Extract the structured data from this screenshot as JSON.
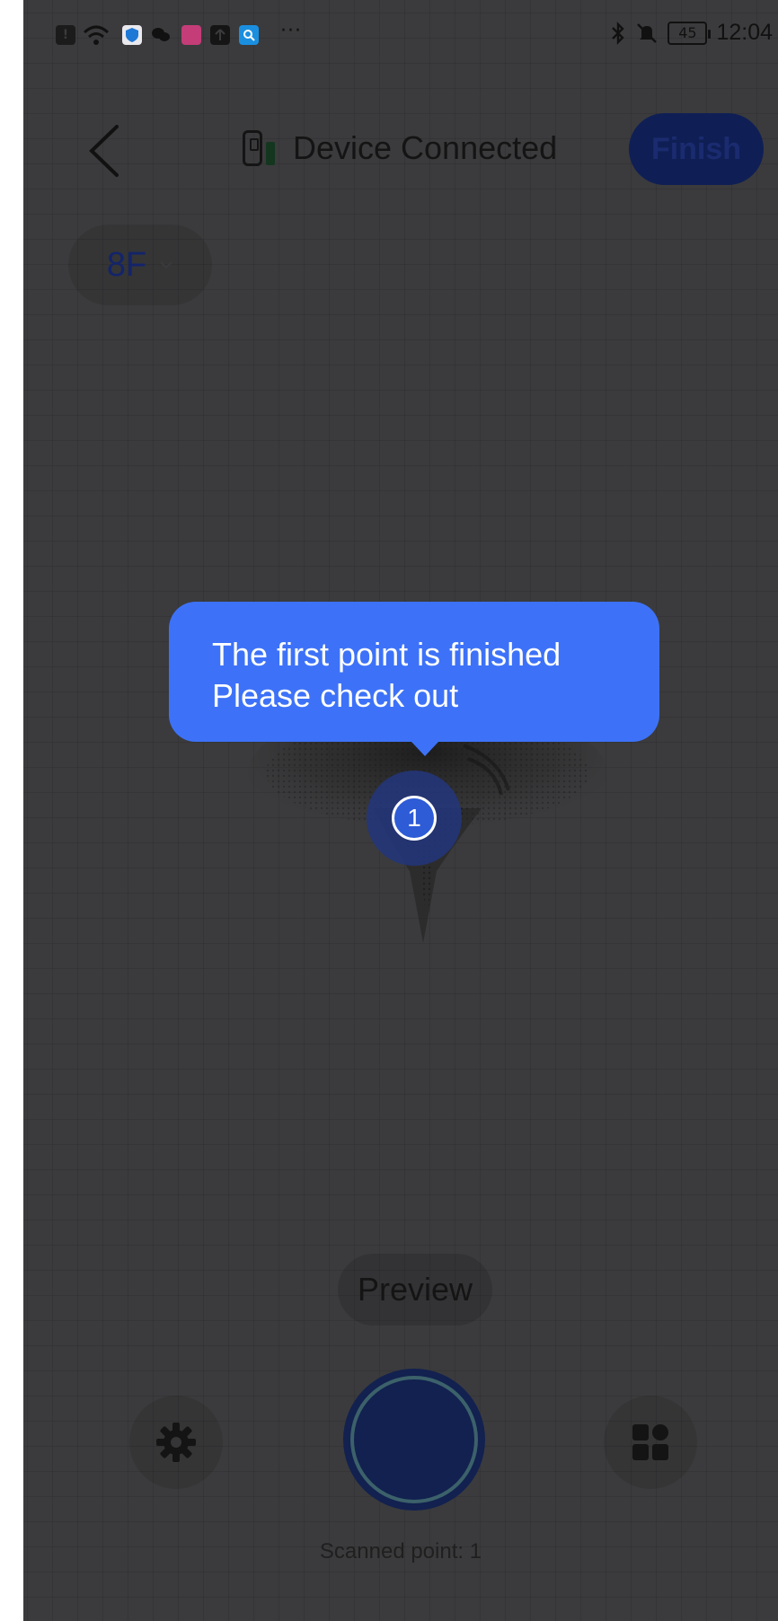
{
  "status_bar": {
    "time": "12:04",
    "battery_level": "45",
    "overflow_dots": "···",
    "left_icons": [
      "notification-icon",
      "wifi-icon",
      "shield-app-icon",
      "wechat-icon",
      "book-app-icon",
      "upload-icon",
      "search-app-icon"
    ],
    "right_icons": [
      "bluetooth-icon",
      "silent-bell-icon",
      "battery-icon"
    ]
  },
  "header": {
    "back_icon": "chevron-left-icon",
    "device_status": "Device Connected",
    "finish_label": "Finish"
  },
  "floor": {
    "label": "8F",
    "icon": "chevron-down-icon"
  },
  "tooltip": {
    "line1": "The first point is finished",
    "line2": "Please check out"
  },
  "scan_point": {
    "number": "1"
  },
  "preview": {
    "label": "Preview"
  },
  "controls": {
    "settings_icon": "gear-icon",
    "grid_icon": "grid-icon"
  },
  "scan_count": {
    "text": "Scanned point:  1"
  },
  "colors": {
    "overlay_background": "#3b3b3d",
    "tooltip_blue": "#3d72f8",
    "finish_button": "#0f1f55",
    "shutter": "#12214f"
  }
}
